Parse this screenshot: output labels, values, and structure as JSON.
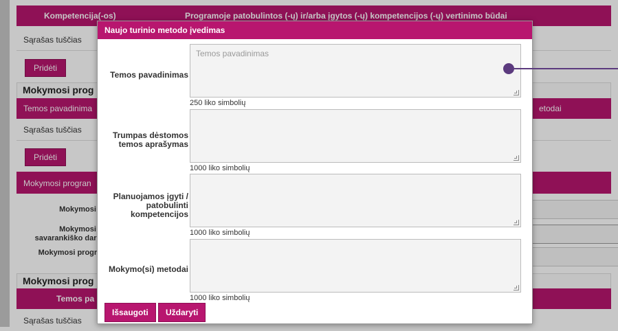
{
  "background": {
    "header_bar": {
      "col1": "Kompetencija(-os)",
      "col2": "Programoje patobulintos (-ų) ir/arba įgytos (-ų) kompetencijos (-ų) vertinimo būdai"
    },
    "empty_list_1": "Sąrašas tuščias",
    "add_button_1": "Pridėti",
    "section_1": "Mokymosi prog",
    "bar_2": {
      "col1": "Temos pavadinima",
      "col2": "etodai"
    },
    "empty_list_2": "Sąrašas tuščias",
    "add_button_2": "Pridėti",
    "bar_3": "Mokymosi progran",
    "label_a": "Mokymosi pr",
    "label_b1": "Mokymosi pr",
    "label_b2": "savarankiško darbo",
    "label_c": "Mokymosi progran",
    "section_2": "Mokymosi prog",
    "bar_4": "Temos pa",
    "empty_list_3": "Sąrašas tuščias"
  },
  "dialog": {
    "title": "Naujo turinio metodo įvedimas",
    "fields": [
      {
        "label": "Temos pavadinimas",
        "placeholder": "Temos pavadinimas",
        "counter": "250 liko simbolių"
      },
      {
        "label": "Trumpas dėstomos temos aprašymas",
        "placeholder": "",
        "counter": "1000 liko simbolių"
      },
      {
        "label": "Planuojamos įgyti / patobulinti kompetencijos",
        "placeholder": "",
        "counter": "1000 liko simbolių"
      },
      {
        "label": "Mokymo(si) metodai",
        "placeholder": "",
        "counter": "1000 liko simbolių"
      }
    ],
    "save_label": "Išsaugoti",
    "close_label": "Uždaryti"
  },
  "colors": {
    "accent": "#b8166f",
    "pointer": "#5b3a7e"
  }
}
